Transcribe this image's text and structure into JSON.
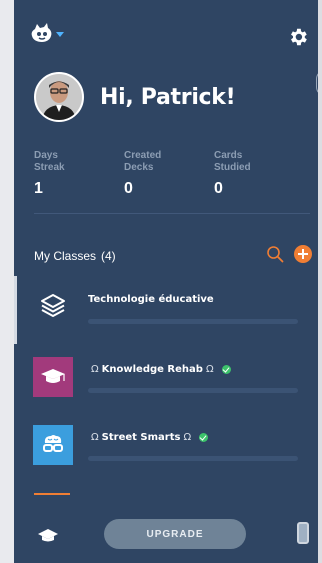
{
  "header": {
    "greeting": "Hi, Patrick!"
  },
  "stats": [
    {
      "label": "Days\nStreak",
      "value": "1"
    },
    {
      "label": "Created\nDecks",
      "value": "0"
    },
    {
      "label": "Cards\nStudied",
      "value": "0"
    }
  ],
  "classes": {
    "title": "My Classes",
    "count": "(4)",
    "items": [
      {
        "prefix": "",
        "name": "Technologie éducative",
        "suffix": "",
        "icon": "layers-icon",
        "icon_bg": "",
        "verified": false,
        "progress": 0
      },
      {
        "prefix": "Ω",
        "name": "Knowledge Rehab",
        "suffix": "Ω",
        "icon": "graduation-cap-icon",
        "icon_bg": "#a23a7c",
        "verified": true,
        "progress": 0
      },
      {
        "prefix": "Ω",
        "name": "Street Smarts",
        "suffix": "Ω",
        "icon": "brain-glasses-icon",
        "icon_bg": "#3b9ede",
        "verified": true,
        "progress": 0
      }
    ]
  },
  "bottom": {
    "upgrade_label": "UPGRADE"
  },
  "colors": {
    "panel": "#2f4563",
    "accent": "#f07e34",
    "verified": "#3cc26b",
    "caret": "#4fb3ff"
  }
}
